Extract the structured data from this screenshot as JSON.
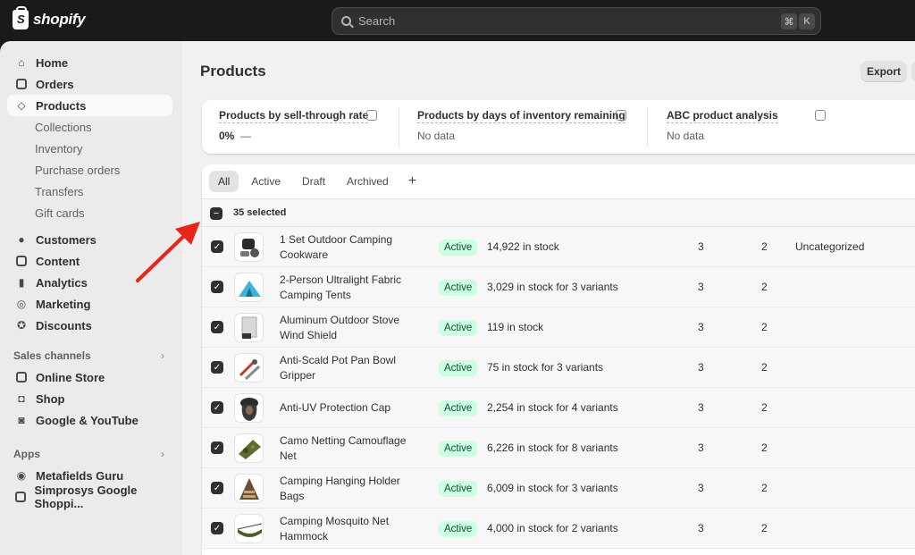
{
  "topbar": {
    "logo_text": "shopify",
    "search_placeholder": "Search",
    "shortcut_key1": "⌘",
    "shortcut_key2": "K"
  },
  "sidebar": {
    "items": [
      {
        "label": "Home",
        "icon": "home-icon"
      },
      {
        "label": "Orders",
        "icon": "inbox-icon"
      },
      {
        "label": "Products",
        "icon": "tag-icon"
      },
      {
        "label": "Customers",
        "icon": "person-icon"
      },
      {
        "label": "Content",
        "icon": "content-icon"
      },
      {
        "label": "Analytics",
        "icon": "bar-chart-icon"
      },
      {
        "label": "Marketing",
        "icon": "target-icon"
      },
      {
        "label": "Discounts",
        "icon": "discount-icon"
      }
    ],
    "product_sub": [
      "Collections",
      "Inventory",
      "Purchase orders",
      "Transfers",
      "Gift cards"
    ],
    "sales_channels_label": "Sales channels",
    "channels": [
      {
        "label": "Online Store",
        "icon": "store-icon"
      },
      {
        "label": "Shop",
        "icon": "shop-icon"
      },
      {
        "label": "Google & YouTube",
        "icon": "google-icon"
      }
    ],
    "apps_label": "Apps",
    "apps": [
      {
        "label": "Metafields Guru",
        "icon": "metafields-icon"
      },
      {
        "label": "Simprosys Google Shoppi...",
        "icon": "simprosys-icon"
      }
    ]
  },
  "main": {
    "title": "Products",
    "export_label": "Export",
    "metrics": [
      {
        "title": "Products by sell-through rate",
        "value": "0%",
        "value_suffix": "—"
      },
      {
        "title": "Products by days of inventory remaining",
        "value": "No data"
      },
      {
        "title": "ABC product analysis",
        "value": "No data"
      }
    ],
    "tabs": [
      "All",
      "Active",
      "Draft",
      "Archived"
    ],
    "tab_add": "+",
    "selected_text": "35 selected",
    "rows": [
      {
        "title": "1 Set Outdoor Camping Cookware",
        "status": "Active",
        "inventory": "14,922 in stock",
        "col1": "3",
        "col2": "2",
        "category": "Uncategorized"
      },
      {
        "title": "2-Person Ultralight Fabric Camping Tents",
        "status": "Active",
        "inventory": "3,029 in stock for 3 variants",
        "col1": "3",
        "col2": "2",
        "category": ""
      },
      {
        "title": "Aluminum Outdoor Stove Wind Shield",
        "status": "Active",
        "inventory": "119 in stock",
        "col1": "3",
        "col2": "2",
        "category": ""
      },
      {
        "title": "Anti-Scald Pot Pan Bowl Gripper",
        "status": "Active",
        "inventory": "75 in stock for 3 variants",
        "col1": "3",
        "col2": "2",
        "category": ""
      },
      {
        "title": "Anti-UV Protection Cap",
        "status": "Active",
        "inventory": "2,254 in stock for 4 variants",
        "col1": "3",
        "col2": "2",
        "category": ""
      },
      {
        "title": "Camo Netting Camouflage Net",
        "status": "Active",
        "inventory": "6,226 in stock for 8 variants",
        "col1": "3",
        "col2": "2",
        "category": ""
      },
      {
        "title": "Camping Hanging Holder Bags",
        "status": "Active",
        "inventory": "6,009 in stock for 3 variants",
        "col1": "3",
        "col2": "2",
        "category": ""
      },
      {
        "title": "Camping Mosquito Net Hammock",
        "status": "Active",
        "inventory": "4,000 in stock for 2 variants",
        "col1": "3",
        "col2": "2",
        "category": ""
      }
    ]
  },
  "colors": {
    "active_badge_bg": "#cdfee1",
    "active_badge_text": "#0c5132",
    "annotation_arrow": "#e8251a"
  }
}
